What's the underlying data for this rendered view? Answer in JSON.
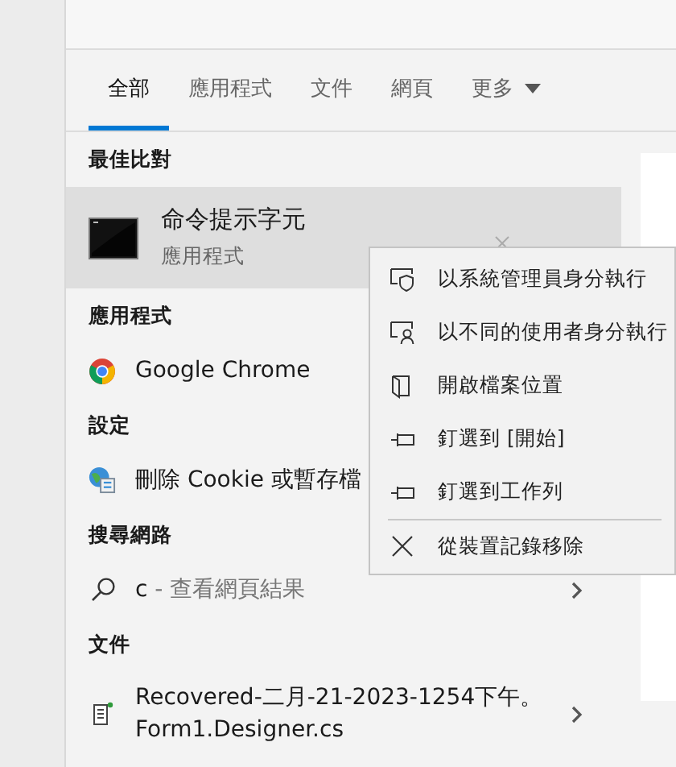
{
  "tabs": [
    {
      "label": "全部",
      "selected": true,
      "kind": "plain"
    },
    {
      "label": "應用程式",
      "selected": false,
      "kind": "plain"
    },
    {
      "label": "文件",
      "selected": false,
      "kind": "plain"
    },
    {
      "label": "網頁",
      "selected": false,
      "kind": "plain"
    },
    {
      "label": "更多",
      "selected": false,
      "kind": "dropdown"
    }
  ],
  "best_match": {
    "header": "最佳比對",
    "item": {
      "title": "命令提示字元",
      "subtitle": "應用程式",
      "selected": true
    }
  },
  "sections": [
    {
      "header": "應用程式",
      "items": [
        {
          "kind": "chrome",
          "title": "Google Chrome"
        }
      ]
    },
    {
      "header": "設定",
      "items": [
        {
          "kind": "settings",
          "title": "刪除 Cookie 或暫存檔"
        }
      ]
    },
    {
      "header": "搜尋網路",
      "items": [
        {
          "kind": "web",
          "title": "c",
          "hint": " - 查看網頁結果",
          "expandable": true
        }
      ]
    },
    {
      "header": "文件",
      "items": [
        {
          "kind": "document",
          "title": "Recovered-二月-21-2023-1254下午。Form1.Designer.cs",
          "expandable": true
        }
      ]
    }
  ],
  "context_menu": {
    "items": [
      {
        "kind": "shield",
        "label": "以系統管理員身分執行",
        "separator_before": false
      },
      {
        "kind": "user",
        "label": "以不同的使用者身分執行",
        "separator_before": false
      },
      {
        "kind": "folder",
        "label": "開啟檔案位置",
        "separator_before": false
      },
      {
        "kind": "pin",
        "label": "釘選到 [開始]",
        "separator_before": false
      },
      {
        "kind": "pin",
        "label": "釘選到工作列",
        "separator_before": false
      },
      {
        "kind": "remove",
        "label": "從裝置記錄移除",
        "separator_before": true
      }
    ]
  }
}
